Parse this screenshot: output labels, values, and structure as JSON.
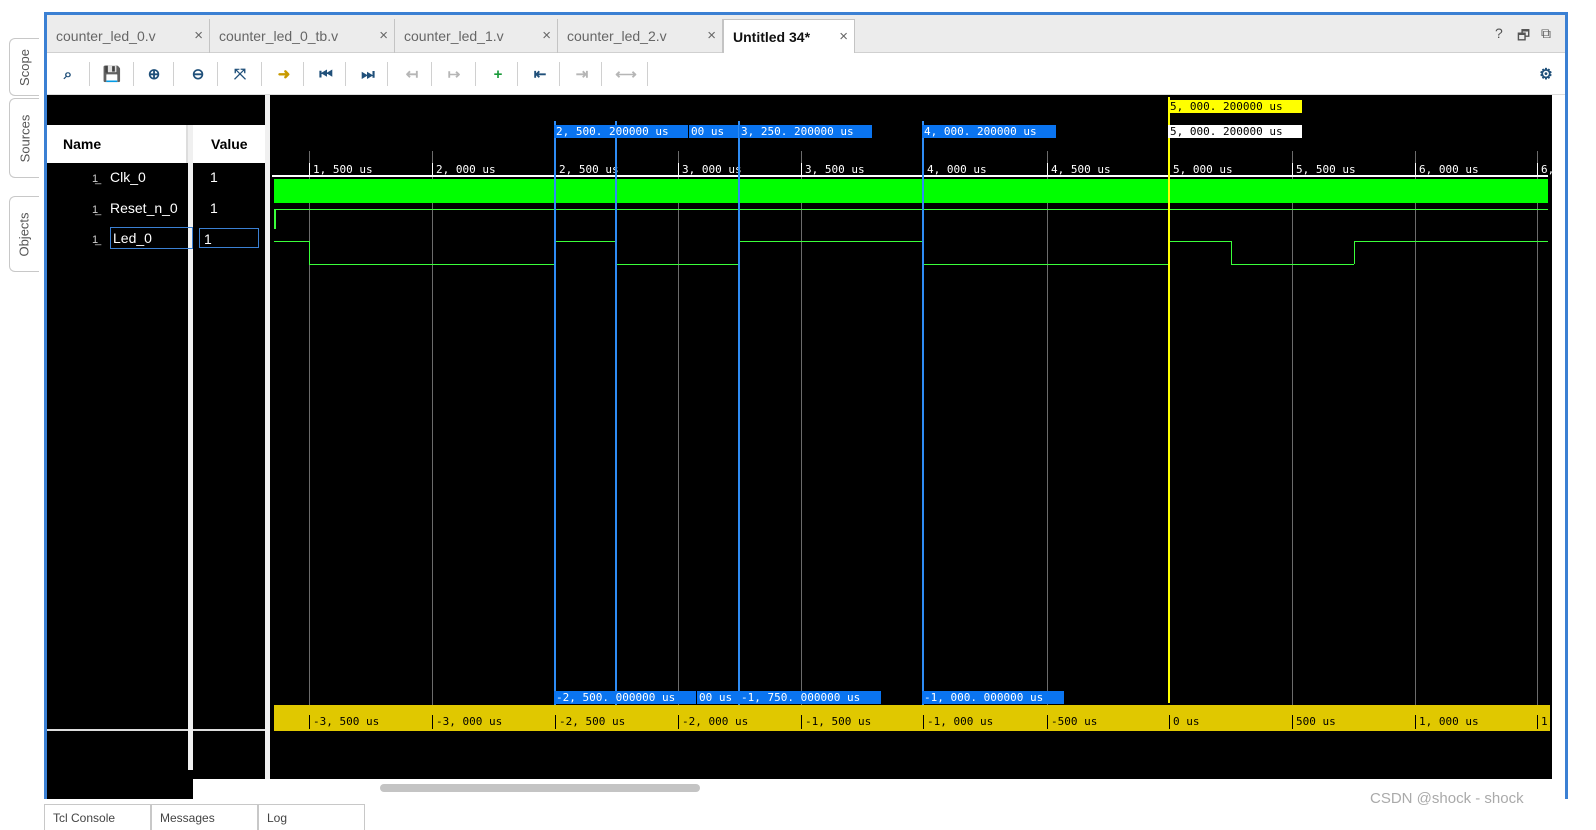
{
  "side_tabs": [
    "Scope",
    "Sources",
    "Objects"
  ],
  "tabs": [
    {
      "label": "counter_led_0.v",
      "active": false
    },
    {
      "label": "counter_led_0_tb.v",
      "active": false
    },
    {
      "label": "counter_led_1.v",
      "active": false
    },
    {
      "label": "counter_led_2.v",
      "active": false
    },
    {
      "label": "Untitled 34*",
      "active": true
    }
  ],
  "tab_close": "×",
  "tab_controls": {
    "help": "?",
    "restore": "🗗",
    "float": "⧉"
  },
  "toolbar": {
    "search": "⌕",
    "save": "💾",
    "zoom_in": "⊕",
    "zoom_out": "⊖",
    "zoom_fit": "⤧",
    "go_cursor": "➜",
    "prev": "⏮",
    "next": "⏭",
    "settings": "⚙"
  },
  "columns": {
    "name": "Name",
    "value": "Value"
  },
  "signals": [
    {
      "name": "Clk_0",
      "value": "1"
    },
    {
      "name": "Reset_n_0",
      "value": "1"
    },
    {
      "name": "Led_0",
      "value": "1"
    }
  ],
  "time_ticks": [
    "1, 500 us",
    "2, 000 us",
    "2, 500 us",
    "3, 000 us",
    "3, 500 us",
    "4, 000 us",
    "4, 500 us",
    "5, 000 us",
    "5, 500 us",
    "6, 000 us",
    "6,"
  ],
  "rel_ticks": [
    "-3, 500 us",
    "-3, 000 us",
    "-2, 500 us",
    "-2, 000 us",
    "-1, 500 us",
    "-1, 000 us",
    "-500 us",
    "0 us",
    "500 us",
    "1, 000 us",
    "1,"
  ],
  "markers_top": {
    "m1": "2, 500. 200000 us",
    "m2": "00 us",
    "m3": "3, 250. 200000 us",
    "m4": "4, 000. 200000 us",
    "cursor": "5, 000. 200000 us",
    "cursor2": "5, 000. 200000 us"
  },
  "markers_bottom": {
    "m1": "-2, 500. 000000 us",
    "m2": "00 us",
    "m3": "-1, 750. 000000 us",
    "m4": "-1, 000. 000000 us"
  },
  "bottom_tabs": [
    "Tcl Console",
    "Messages",
    "Log"
  ],
  "watermark": "CSDN @shock - shock",
  "colors": {
    "clock": "#00ff00",
    "cursor": "#ffff00",
    "marker": "#0a74f0",
    "accent": "#3b80d3"
  }
}
